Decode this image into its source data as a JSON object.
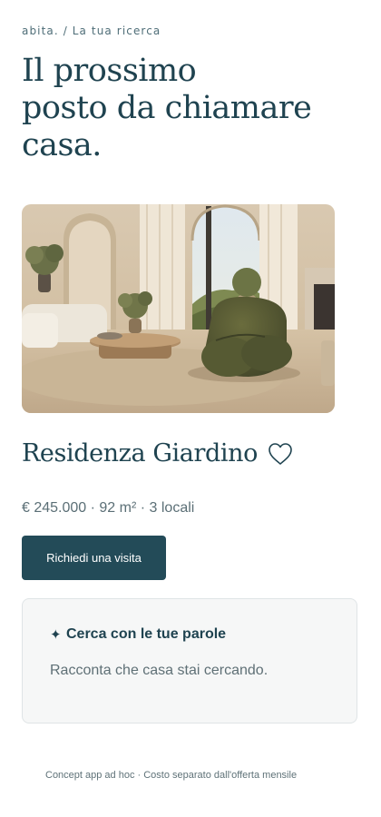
{
  "breadcrumb": "abita. / La tua ricerca",
  "headline": {
    "line1": "Il prossimo",
    "line2": "posto da chiamare",
    "line3": "casa."
  },
  "listing": {
    "photo_alt": "Soggiorno luminoso con poltrona verde",
    "name": "Residenza Giardino",
    "favorite_icon": "heart-outline-icon",
    "facts": "€ 245.000 · 92 m² · 3 locali",
    "cta_label": "Richiedi una visita"
  },
  "search": {
    "icon": "sparkle-icon",
    "title": "Cerca con le tue parole",
    "prompt": "Racconta che casa stai cercando."
  },
  "footer": {
    "note": "Concept app ad hoc · Costo separato dall'offerta mensile"
  },
  "colors": {
    "primary": "#234b58",
    "text": "#1f4350",
    "muted": "#5b6f76",
    "card_bg": "#f6f7f7",
    "card_border": "#dfe4e6"
  }
}
